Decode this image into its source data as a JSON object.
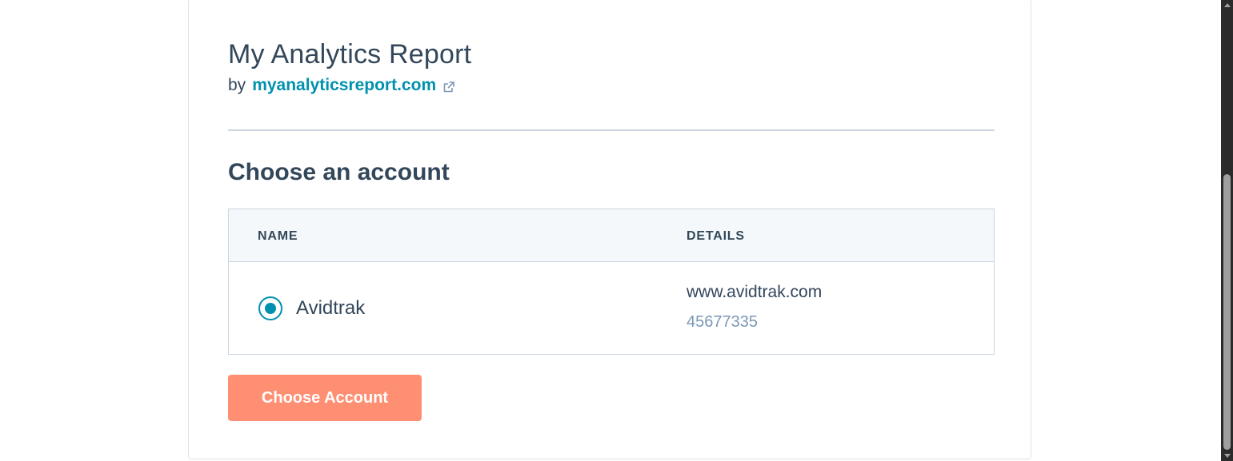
{
  "app": {
    "title": "My Analytics Report",
    "by_prefix": "by",
    "vendor_link": "myanalyticsreport.com"
  },
  "section": {
    "title": "Choose an account"
  },
  "table": {
    "columns": {
      "name": "NAME",
      "details": "DETAILS"
    },
    "rows": [
      {
        "selected": true,
        "name": "Avidtrak",
        "url": "www.avidtrak.com",
        "id": "45677335"
      }
    ]
  },
  "actions": {
    "choose_label": "Choose Account"
  },
  "colors": {
    "accent": "#0091ae",
    "button": "#ff8f73",
    "text": "#33475b",
    "muted": "#7c98b6"
  },
  "icons": {
    "external_link": "external-link-icon"
  }
}
